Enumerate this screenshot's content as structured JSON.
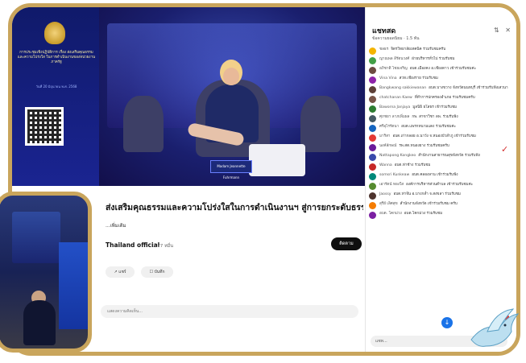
{
  "video": {
    "banner_text": "การประชุมเชิงปฏิบัติการ เรื่อง ส่งเสริมคุณธรรมและความโปร่งใส ในการดำเนินงานของหน่วยงานภาครัฐ",
    "banner_sub": "วันที่ 20 มิถุนายน พ.ศ. 2568",
    "nameplate": "Madam Jeannette Fuhrmann"
  },
  "info": {
    "title": "ส่งเสริมคุณธรรมและความโปร่งใสในการดำเนินงานฯ สู่การยกระดับธรรมาภิบาลภาครัฐ",
    "more": "...เพิ่มเติม",
    "channel": "Thailand official",
    "subscribers": "2.77 หมื่น",
    "subscribe_label": "ติดตาม",
    "share_label": "แชร์",
    "save_label": "บันทึก",
    "comment_placeholder": "แสดงความคิดเห็น..."
  },
  "chat": {
    "title": "แชทสด",
    "subtitle": "ข้อความยอดนิยม · 1.5 พัน",
    "messages": [
      {
        "author": "ชลธร",
        "text": "จิตรวิทยาลัยเทคนิค ร่วมรับชมครับ",
        "color": "#f4b400"
      },
      {
        "author": "ญาณพล ลีรัตนวงศ์",
        "text": "ฝ่ายบริหารทั่วไป ร่วมรับชม",
        "color": "#43a047"
      },
      {
        "author": "อภิชาติ ไชยเจริญ",
        "text": "อบต.เมืองคง อ.เชียงดาว เข้าร่วมรับชมค่ะ",
        "color": "#6d4c41"
      },
      {
        "author": "Vina Vina",
        "text": "สวท.เชียงราย ร่วมรับชม",
        "color": "#8e24aa"
      },
      {
        "author": "Bangkwang sakkiewanan",
        "text": "อบต.บางขวาง จังหวัดนนทบุรี เข้าร่วมรับฟังเสวนา",
        "color": "#5d4037"
      },
      {
        "author": "chatchanan Kaew",
        "text": "ที่ทำการปกครองอำเภอ ร่วมรับชมครับ",
        "color": "#795548"
      },
      {
        "author": "Baworna Janjaya",
        "text": "มูลนิธิ ยโสธร เข้าร่วมรับชม",
        "color": "#2e7d32"
      },
      {
        "author": "ศุภชยา ลาภเพิ่มผล",
        "text": "กพ. สาขาวิชา ลพ. ร่วมรับฟัง",
        "color": "#455a64"
      },
      {
        "author": "ศรีอุไรรัตนา",
        "text": "อบต.แพรกหนามแดง ร่วมรับชมค่ะ",
        "color": "#1565c0"
      },
      {
        "author": "มาริสา",
        "text": "อบต.เก่ากลอย อ.นาวัง จ.หนองบัวลำภู เข้าร่วมรับชม",
        "color": "#e53935"
      },
      {
        "author": "นงค์ลักษณ์",
        "text": "รพ.สต.หนองยาง ร่วมรับชมครับ",
        "color": "#6a1b9a"
      },
      {
        "author": "Nattapong Kongkeo",
        "text": "สำนักงานสาธารณสุขจังหวัด ร่วมรับฟัง",
        "color": "#3949ab"
      },
      {
        "author": "Wanna",
        "text": "อบต.ท่าช้าง ร่วมรับชม",
        "color": "#c62828"
      },
      {
        "author": "somsri Kunkeaw",
        "text": "อบต.คลองลาน เข้าร่วมรับฟัง",
        "color": "#00897b"
      },
      {
        "author": "เอารัตน์ ทองใส",
        "text": "องค์การบริหารส่วนตำบล เข้าร่วมรับชมค่ะ",
        "color": "#558b2f"
      },
      {
        "author": "Jaossy",
        "text": "อบต.ท่าจีน อ.บางกล่ำ จ.สงขลา ร่วมรับชม",
        "color": "#4e342e"
      },
      {
        "author": "สุรีย์ เลิศสุข",
        "text": "สำนักงานจังหวัด เข้าร่วมรับชม ครับ",
        "color": "#f57c00"
      },
      {
        "author": "อบต. โคกม่วง",
        "text": "อบต.โคกม่วง ร่วมรับชม",
        "color": "#7b1fa2"
      }
    ],
    "input_placeholder": "แชท..."
  }
}
